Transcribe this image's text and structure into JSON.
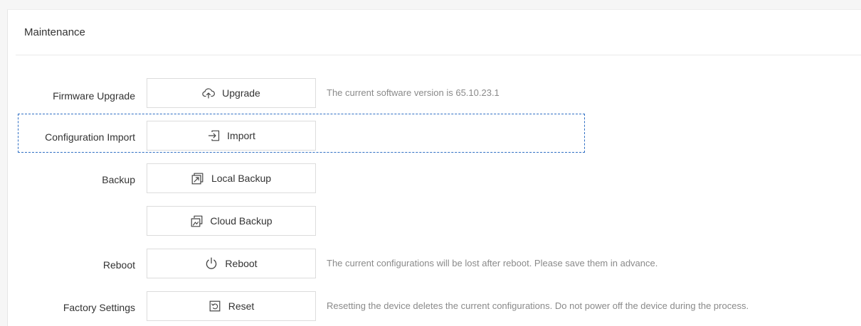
{
  "page": {
    "title": "Maintenance"
  },
  "rows": {
    "firmware": {
      "label": "Firmware Upgrade",
      "button_label": "Upgrade",
      "button_icon": "cloud-upload-icon",
      "hint": "The current software version is 65.10.23.1"
    },
    "config_import": {
      "label": "Configuration Import",
      "button_label": "Import",
      "button_icon": "import-icon"
    },
    "backup": {
      "label": "Backup",
      "local_button_label": "Local Backup",
      "local_button_icon": "local-backup-icon",
      "cloud_button_label": "Cloud Backup",
      "cloud_button_icon": "cloud-backup-icon"
    },
    "reboot": {
      "label": "Reboot",
      "button_label": "Reboot",
      "button_icon": "power-icon",
      "hint": "The current configurations will be lost after reboot. Please save them in advance."
    },
    "factory": {
      "label": "Factory Settings",
      "button_label": "Reset",
      "button_icon": "reset-icon",
      "hint": "Resetting the device deletes the current configurations. Do not power off the device during the process."
    }
  },
  "colors": {
    "focus_outline": "#2f6fc4",
    "hint_text": "#8a8a8a",
    "border": "#dcdcdc"
  }
}
